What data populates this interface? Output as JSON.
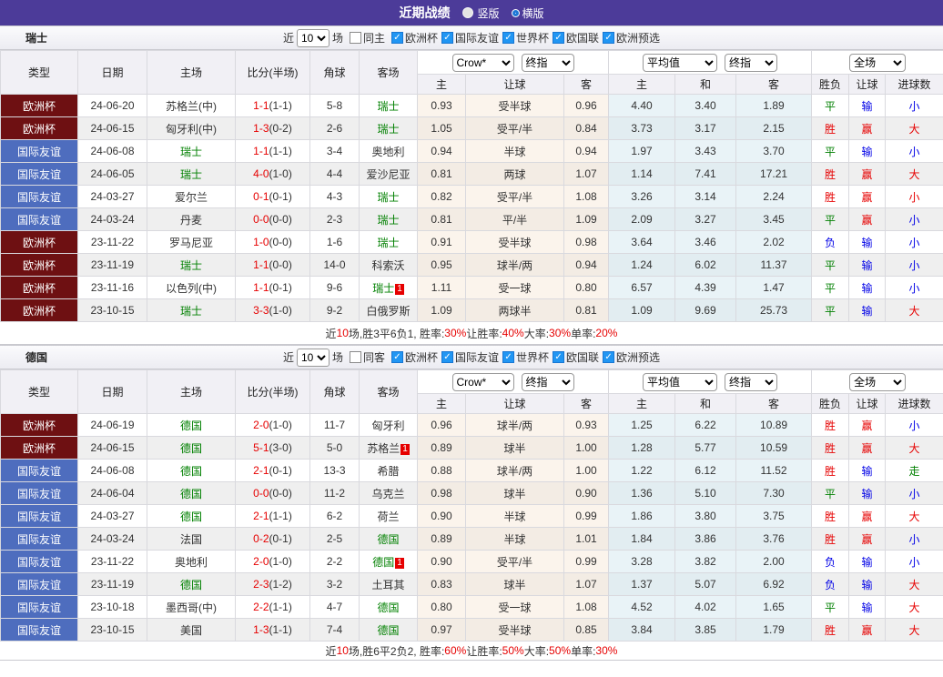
{
  "colors": {
    "accent_purple": "#4C3B99",
    "euro_cup_bg": "#6E1012",
    "friendly_bg": "#4E6DBE",
    "win_red": "#E60000",
    "draw_green": "#008000",
    "loss_blue": "#0000E6",
    "odds_col_tint": "#FBF4EC",
    "avg_col_tint": "#E9F3F7",
    "checkbox_blue": "#2196F3"
  },
  "titlebar": {
    "title": "近期战绩",
    "radio_vertical": "竖版",
    "radio_horizontal": "横版"
  },
  "table_header": {
    "cols6": [
      "类型",
      "日期",
      "主场",
      "比分(半场)",
      "角球",
      "客场"
    ],
    "sub": [
      "主",
      "让球",
      "客",
      "主",
      "和",
      "客",
      "胜负",
      "让球",
      "进球数"
    ],
    "selects": {
      "company": "Crow*",
      "company_time": "终指",
      "avg": "平均值",
      "avg_time": "终指",
      "scope": "全场"
    }
  },
  "sections": [
    {
      "name": "瑞士",
      "near_label": "近",
      "count": "10",
      "games_label": "场",
      "same_label": "同主",
      "leagues": [
        "欧洲杯",
        "国际友谊",
        "世界杯",
        "欧国联",
        "欧洲预选"
      ],
      "rows": [
        {
          "type": "欧洲杯",
          "tk": "euro",
          "date": "24-06-20",
          "home": "苏格兰(中)",
          "hg": false,
          "score": "1-1",
          "half": "(1-1)",
          "corner": "5-8",
          "away": "瑞士",
          "ag": true,
          "badge": "",
          "o1": "0.93",
          "hc": "受半球",
          "o2": "0.96",
          "m1": "4.40",
          "m2": "3.40",
          "m3": "1.89",
          "r1": [
            "平",
            "g"
          ],
          "r2": [
            "输",
            "b"
          ],
          "r3": [
            "小",
            "b"
          ]
        },
        {
          "type": "欧洲杯",
          "tk": "euro",
          "date": "24-06-15",
          "home": "匈牙利(中)",
          "hg": false,
          "score": "1-3",
          "half": "(0-2)",
          "corner": "2-6",
          "away": "瑞士",
          "ag": true,
          "badge": "",
          "o1": "1.05",
          "hc": "受平/半",
          "o2": "0.84",
          "m1": "3.73",
          "m2": "3.17",
          "m3": "2.15",
          "r1": [
            "胜",
            "r"
          ],
          "r2": [
            "赢",
            "r"
          ],
          "r3": [
            "大",
            "r"
          ]
        },
        {
          "type": "国际友谊",
          "tk": "frie",
          "date": "24-06-08",
          "home": "瑞士",
          "hg": true,
          "score": "1-1",
          "half": "(1-1)",
          "corner": "3-4",
          "away": "奥地利",
          "ag": false,
          "badge": "",
          "o1": "0.94",
          "hc": "半球",
          "o2": "0.94",
          "m1": "1.97",
          "m2": "3.43",
          "m3": "3.70",
          "r1": [
            "平",
            "g"
          ],
          "r2": [
            "输",
            "b"
          ],
          "r3": [
            "小",
            "b"
          ]
        },
        {
          "type": "国际友谊",
          "tk": "frie",
          "date": "24-06-05",
          "home": "瑞士",
          "hg": true,
          "score": "4-0",
          "half": "(1-0)",
          "corner": "4-4",
          "away": "爱沙尼亚",
          "ag": false,
          "badge": "",
          "o1": "0.81",
          "hc": "两球",
          "o2": "1.07",
          "m1": "1.14",
          "m2": "7.41",
          "m3": "17.21",
          "r1": [
            "胜",
            "r"
          ],
          "r2": [
            "赢",
            "r"
          ],
          "r3": [
            "大",
            "r"
          ]
        },
        {
          "type": "国际友谊",
          "tk": "frie",
          "date": "24-03-27",
          "home": "爱尔兰",
          "hg": false,
          "score": "0-1",
          "half": "(0-1)",
          "corner": "4-3",
          "away": "瑞士",
          "ag": true,
          "badge": "",
          "o1": "0.82",
          "hc": "受平/半",
          "o2": "1.08",
          "m1": "3.26",
          "m2": "3.14",
          "m3": "2.24",
          "r1": [
            "胜",
            "r"
          ],
          "r2": [
            "赢",
            "r"
          ],
          "r3": [
            "小",
            "r"
          ]
        },
        {
          "type": "国际友谊",
          "tk": "frie",
          "date": "24-03-24",
          "home": "丹麦",
          "hg": false,
          "score": "0-0",
          "half": "(0-0)",
          "corner": "2-3",
          "away": "瑞士",
          "ag": true,
          "badge": "",
          "o1": "0.81",
          "hc": "平/半",
          "o2": "1.09",
          "m1": "2.09",
          "m2": "3.27",
          "m3": "3.45",
          "r1": [
            "平",
            "g"
          ],
          "r2": [
            "赢",
            "r"
          ],
          "r3": [
            "小",
            "b"
          ]
        },
        {
          "type": "欧洲杯",
          "tk": "euro",
          "date": "23-11-22",
          "home": "罗马尼亚",
          "hg": false,
          "score": "1-0",
          "half": "(0-0)",
          "corner": "1-6",
          "away": "瑞士",
          "ag": true,
          "badge": "",
          "o1": "0.91",
          "hc": "受半球",
          "o2": "0.98",
          "m1": "3.64",
          "m2": "3.46",
          "m3": "2.02",
          "r1": [
            "负",
            "b"
          ],
          "r2": [
            "输",
            "b"
          ],
          "r3": [
            "小",
            "b"
          ]
        },
        {
          "type": "欧洲杯",
          "tk": "euro",
          "date": "23-11-19",
          "home": "瑞士",
          "hg": true,
          "score": "1-1",
          "half": "(0-0)",
          "corner": "14-0",
          "away": "科索沃",
          "ag": false,
          "badge": "",
          "o1": "0.95",
          "hc": "球半/两",
          "o2": "0.94",
          "m1": "1.24",
          "m2": "6.02",
          "m3": "11.37",
          "r1": [
            "平",
            "g"
          ],
          "r2": [
            "输",
            "b"
          ],
          "r3": [
            "小",
            "b"
          ]
        },
        {
          "type": "欧洲杯",
          "tk": "euro",
          "date": "23-11-16",
          "home": "以色列(中)",
          "hg": false,
          "score": "1-1",
          "half": "(0-1)",
          "corner": "9-6",
          "away": "瑞士",
          "ag": true,
          "badge": "1",
          "o1": "1.11",
          "hc": "受一球",
          "o2": "0.80",
          "m1": "6.57",
          "m2": "4.39",
          "m3": "1.47",
          "r1": [
            "平",
            "g"
          ],
          "r2": [
            "输",
            "b"
          ],
          "r3": [
            "小",
            "b"
          ]
        },
        {
          "type": "欧洲杯",
          "tk": "euro",
          "date": "23-10-15",
          "home": "瑞士",
          "hg": true,
          "score": "3-3",
          "half": "(1-0)",
          "corner": "9-2",
          "away": "白俄罗斯",
          "ag": false,
          "badge": "",
          "o1": "1.09",
          "hc": "两球半",
          "o2": "0.81",
          "m1": "1.09",
          "m2": "9.69",
          "m3": "25.73",
          "r1": [
            "平",
            "g"
          ],
          "r2": [
            "输",
            "b"
          ],
          "r3": [
            "大",
            "r"
          ]
        }
      ],
      "summary": [
        [
          "近",
          0
        ],
        [
          "10",
          1
        ],
        [
          "场,胜3平6负1, 胜率:",
          0
        ],
        [
          "30%",
          1
        ],
        [
          " 让胜率:",
          0
        ],
        [
          "40%",
          1
        ],
        [
          " 大率:",
          0
        ],
        [
          "30%",
          1
        ],
        [
          " 单率:",
          0
        ],
        [
          "20%",
          1
        ]
      ]
    },
    {
      "name": "德国",
      "near_label": "近",
      "count": "10",
      "games_label": "场",
      "same_label": "同客",
      "leagues": [
        "欧洲杯",
        "国际友谊",
        "世界杯",
        "欧国联",
        "欧洲预选"
      ],
      "rows": [
        {
          "type": "欧洲杯",
          "tk": "euro",
          "date": "24-06-19",
          "home": "德国",
          "hg": true,
          "score": "2-0",
          "half": "(1-0)",
          "corner": "11-7",
          "away": "匈牙利",
          "ag": false,
          "badge": "",
          "o1": "0.96",
          "hc": "球半/两",
          "o2": "0.93",
          "m1": "1.25",
          "m2": "6.22",
          "m3": "10.89",
          "r1": [
            "胜",
            "r"
          ],
          "r2": [
            "赢",
            "r"
          ],
          "r3": [
            "小",
            "b"
          ]
        },
        {
          "type": "欧洲杯",
          "tk": "euro",
          "date": "24-06-15",
          "home": "德国",
          "hg": true,
          "score": "5-1",
          "half": "(3-0)",
          "corner": "5-0",
          "away": "苏格兰",
          "ag": false,
          "badge": "1",
          "o1": "0.89",
          "hc": "球半",
          "o2": "1.00",
          "m1": "1.28",
          "m2": "5.77",
          "m3": "10.59",
          "r1": [
            "胜",
            "r"
          ],
          "r2": [
            "赢",
            "r"
          ],
          "r3": [
            "大",
            "r"
          ]
        },
        {
          "type": "国际友谊",
          "tk": "frie",
          "date": "24-06-08",
          "home": "德国",
          "hg": true,
          "score": "2-1",
          "half": "(0-1)",
          "corner": "13-3",
          "away": "希腊",
          "ag": false,
          "badge": "",
          "o1": "0.88",
          "hc": "球半/两",
          "o2": "1.00",
          "m1": "1.22",
          "m2": "6.12",
          "m3": "11.52",
          "r1": [
            "胜",
            "r"
          ],
          "r2": [
            "输",
            "b"
          ],
          "r3": [
            "走",
            "g"
          ]
        },
        {
          "type": "国际友谊",
          "tk": "frie",
          "date": "24-06-04",
          "home": "德国",
          "hg": true,
          "score": "0-0",
          "half": "(0-0)",
          "corner": "11-2",
          "away": "乌克兰",
          "ag": false,
          "badge": "",
          "o1": "0.98",
          "hc": "球半",
          "o2": "0.90",
          "m1": "1.36",
          "m2": "5.10",
          "m3": "7.30",
          "r1": [
            "平",
            "g"
          ],
          "r2": [
            "输",
            "b"
          ],
          "r3": [
            "小",
            "b"
          ]
        },
        {
          "type": "国际友谊",
          "tk": "frie",
          "date": "24-03-27",
          "home": "德国",
          "hg": true,
          "score": "2-1",
          "half": "(1-1)",
          "corner": "6-2",
          "away": "荷兰",
          "ag": false,
          "badge": "",
          "o1": "0.90",
          "hc": "半球",
          "o2": "0.99",
          "m1": "1.86",
          "m2": "3.80",
          "m3": "3.75",
          "r1": [
            "胜",
            "r"
          ],
          "r2": [
            "赢",
            "r"
          ],
          "r3": [
            "大",
            "r"
          ]
        },
        {
          "type": "国际友谊",
          "tk": "frie",
          "date": "24-03-24",
          "home": "法国",
          "hg": false,
          "score": "0-2",
          "half": "(0-1)",
          "corner": "2-5",
          "away": "德国",
          "ag": true,
          "badge": "",
          "o1": "0.89",
          "hc": "半球",
          "o2": "1.01",
          "m1": "1.84",
          "m2": "3.86",
          "m3": "3.76",
          "r1": [
            "胜",
            "r"
          ],
          "r2": [
            "赢",
            "r"
          ],
          "r3": [
            "小",
            "b"
          ]
        },
        {
          "type": "国际友谊",
          "tk": "frie",
          "date": "23-11-22",
          "home": "奥地利",
          "hg": false,
          "score": "2-0",
          "half": "(1-0)",
          "corner": "2-2",
          "away": "德国",
          "ag": true,
          "badge": "1",
          "o1": "0.90",
          "hc": "受平/半",
          "o2": "0.99",
          "m1": "3.28",
          "m2": "3.82",
          "m3": "2.00",
          "r1": [
            "负",
            "b"
          ],
          "r2": [
            "输",
            "b"
          ],
          "r3": [
            "小",
            "b"
          ]
        },
        {
          "type": "国际友谊",
          "tk": "frie",
          "date": "23-11-19",
          "home": "德国",
          "hg": true,
          "score": "2-3",
          "half": "(1-2)",
          "corner": "3-2",
          "away": "土耳其",
          "ag": false,
          "badge": "",
          "o1": "0.83",
          "hc": "球半",
          "o2": "1.07",
          "m1": "1.37",
          "m2": "5.07",
          "m3": "6.92",
          "r1": [
            "负",
            "b"
          ],
          "r2": [
            "输",
            "b"
          ],
          "r3": [
            "大",
            "r"
          ]
        },
        {
          "type": "国际友谊",
          "tk": "frie",
          "date": "23-10-18",
          "home": "墨西哥(中)",
          "hg": false,
          "score": "2-2",
          "half": "(1-1)",
          "corner": "4-7",
          "away": "德国",
          "ag": true,
          "badge": "",
          "o1": "0.80",
          "hc": "受一球",
          "o2": "1.08",
          "m1": "4.52",
          "m2": "4.02",
          "m3": "1.65",
          "r1": [
            "平",
            "g"
          ],
          "r2": [
            "输",
            "b"
          ],
          "r3": [
            "大",
            "r"
          ]
        },
        {
          "type": "国际友谊",
          "tk": "frie",
          "date": "23-10-15",
          "home": "美国",
          "hg": false,
          "score": "1-3",
          "half": "(1-1)",
          "corner": "7-4",
          "away": "德国",
          "ag": true,
          "badge": "",
          "o1": "0.97",
          "hc": "受半球",
          "o2": "0.85",
          "m1": "3.84",
          "m2": "3.85",
          "m3": "1.79",
          "r1": [
            "胜",
            "r"
          ],
          "r2": [
            "赢",
            "r"
          ],
          "r3": [
            "大",
            "r"
          ]
        }
      ],
      "summary": [
        [
          "近",
          0
        ],
        [
          "10",
          1
        ],
        [
          "场,胜6平2负2, 胜率:",
          0
        ],
        [
          "60%",
          1
        ],
        [
          " 让胜率:",
          0
        ],
        [
          "50%",
          1
        ],
        [
          " 大率:",
          0
        ],
        [
          "50%",
          1
        ],
        [
          " 单率:",
          0
        ],
        [
          "30%",
          1
        ]
      ]
    }
  ]
}
